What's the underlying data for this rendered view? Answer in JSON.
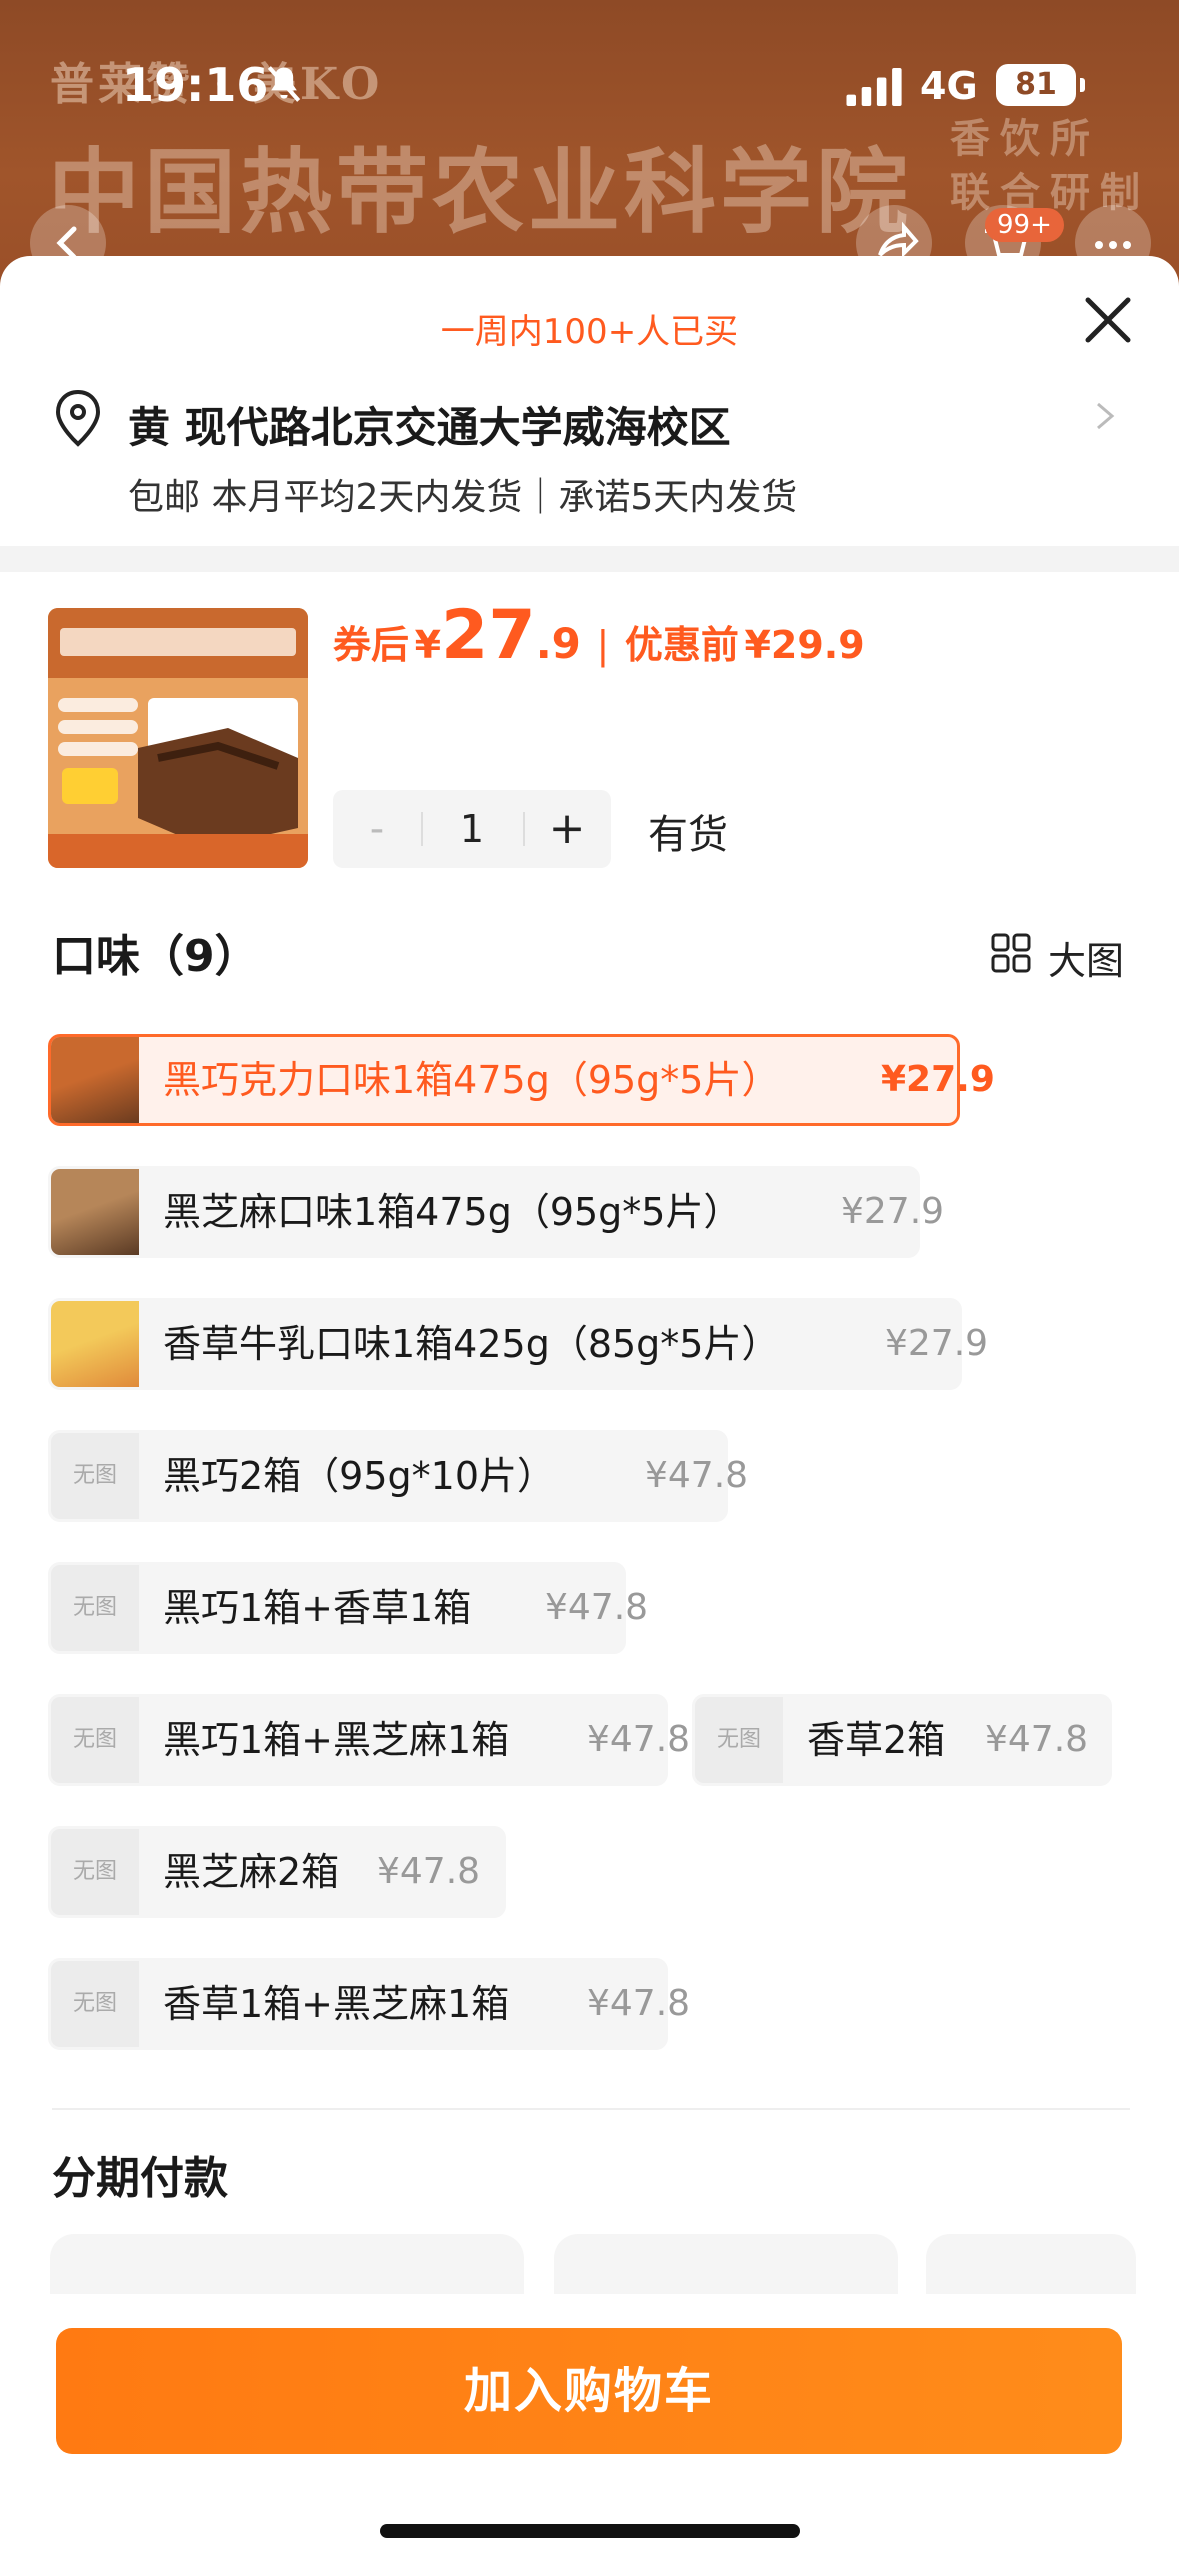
{
  "status_bar": {
    "time": "19:16",
    "network": "4G",
    "battery": "81"
  },
  "background": {
    "brand": "普莱赞 · 美KO",
    "title": "中国热带农业科学院",
    "subtitle": "香饮所 联合研制"
  },
  "nav": {
    "cart_badge": "99+"
  },
  "sheet": {
    "bought_note": "一周内100+人已买",
    "address": "黄 现代路北京交通大学威海校区",
    "shipping": "包邮 本月平均2天内发货｜承诺5天内发货"
  },
  "product": {
    "price_after_label": "券后",
    "currency": "¥",
    "price_int": "27",
    "price_dec": ".9",
    "price_before_label": "优惠前",
    "price_before": "¥29.9",
    "quantity": "1",
    "minus": "-",
    "plus": "+",
    "stock": "有货"
  },
  "flavor": {
    "title": "口味（9）",
    "big_pic": "大图",
    "no_image": "无图",
    "options": [
      {
        "name": "黑巧克力口味1箱475g（95g*5片）",
        "price": "¥27.9",
        "selected": true,
        "thumb": "brown"
      },
      {
        "name": "黑芝麻口味1箱475g（95g*5片）",
        "price": "¥27.9",
        "selected": false,
        "thumb": "dark"
      },
      {
        "name": "香草牛乳口味1箱425g（85g*5片）",
        "price": "¥27.9",
        "selected": false,
        "thumb": "yellow"
      },
      {
        "name": "黑巧2箱（95g*10片）",
        "price": "¥47.8",
        "selected": false,
        "thumb": ""
      },
      {
        "name": "黑巧1箱+香草1箱",
        "price": "¥47.8",
        "selected": false,
        "thumb": ""
      },
      {
        "name": "黑巧1箱+黑芝麻1箱",
        "price": "¥47.8",
        "selected": false,
        "thumb": ""
      },
      {
        "name": "香草2箱",
        "price": "¥47.8",
        "selected": false,
        "thumb": ""
      },
      {
        "name": "黑芝麻2箱",
        "price": "¥47.8",
        "selected": false,
        "thumb": ""
      },
      {
        "name": "香草1箱+黑芝麻1箱",
        "price": "¥47.8",
        "selected": false,
        "thumb": ""
      }
    ]
  },
  "installment": {
    "title": "分期付款"
  },
  "cta": {
    "label": "加入购物车"
  },
  "colors": {
    "accent": "#ff5a1f",
    "cta": "#ff7a12"
  }
}
